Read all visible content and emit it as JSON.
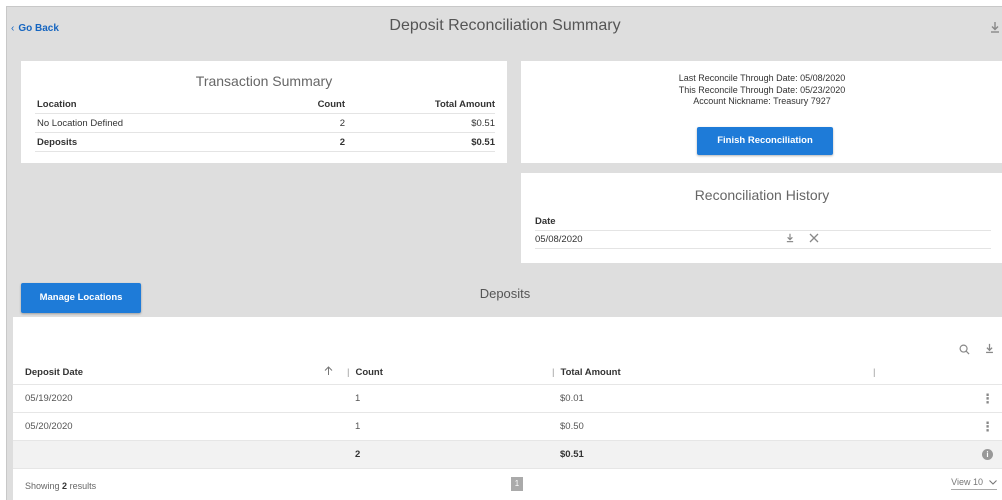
{
  "header": {
    "back_label": "Go Back",
    "title": "Deposit Reconciliation Summary"
  },
  "transaction_summary": {
    "title": "Transaction Summary",
    "columns": [
      "Location",
      "Count",
      "Total Amount"
    ],
    "rows": [
      {
        "location": "No Location Defined",
        "count": "2",
        "amount": "$0.51"
      },
      {
        "location": "Deposits",
        "count": "2",
        "amount": "$0.51"
      }
    ]
  },
  "reconcile": {
    "last_through": "Last Reconcile Through Date: 05/08/2020",
    "this_through": "This Reconcile Through Date: 05/23/2020",
    "nickname": "Account Nickname: Treasury 7927",
    "finish_label": "Finish Reconciliation"
  },
  "history": {
    "title": "Reconciliation History",
    "column": "Date",
    "rows": [
      {
        "date": "05/08/2020"
      }
    ]
  },
  "deposits": {
    "manage_label": "Manage Locations",
    "title": "Deposits",
    "columns": {
      "date": "Deposit Date",
      "count": "Count",
      "amount": "Total Amount"
    },
    "rows": [
      {
        "date": "05/19/2020",
        "count": "1",
        "amount": "$0.01"
      },
      {
        "date": "05/20/2020",
        "count": "1",
        "amount": "$0.50"
      }
    ],
    "total": {
      "count": "2",
      "amount": "$0.51"
    },
    "showing_prefix": "Showing",
    "showing_count": "2",
    "showing_suffix": "results",
    "page": "1",
    "view_label": "View 10"
  },
  "icons": {
    "download": "download-icon",
    "search": "search-icon",
    "close": "close-icon",
    "sort": "sort-ascending-icon",
    "more": "more-vertical-icon",
    "info": "info-icon",
    "chevron": "chevron-down-icon"
  },
  "colors": {
    "accent": "#1e7bd8",
    "link": "#1565c0",
    "background": "#dedede"
  }
}
